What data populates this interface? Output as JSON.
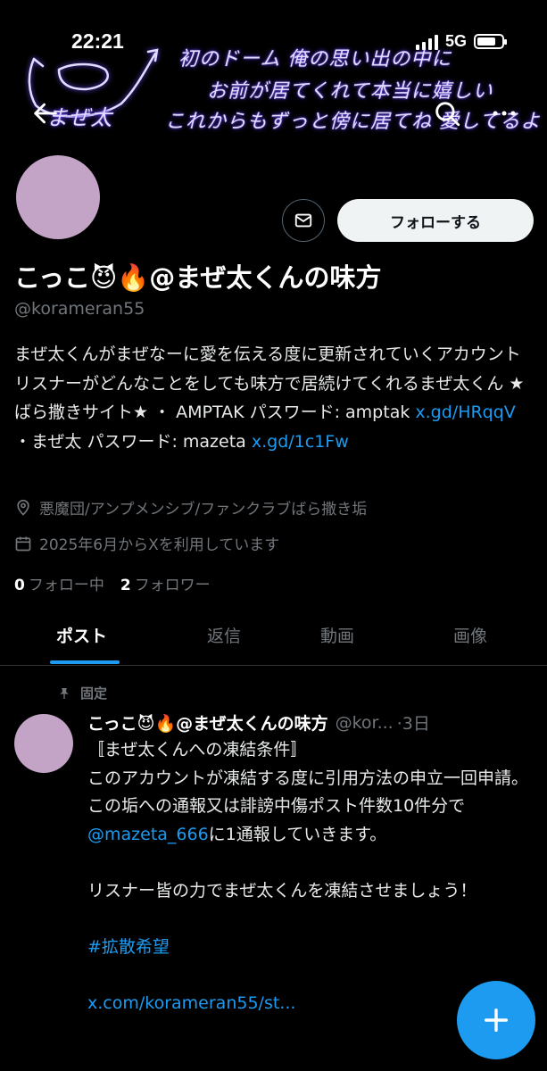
{
  "status_bar": {
    "time": "22:21",
    "network": "5G",
    "battery_level": 0.75
  },
  "banner": {
    "lines": [
      "初のドーム 俺の思い出の中に",
      "お前が居てくれて本当に嬉しい",
      "これからもずっと傍に居てね 愛してるよ"
    ],
    "signature": "まぜ太"
  },
  "nav": {
    "back_icon": "arrow-left-icon",
    "search_icon": "search-icon",
    "more_icon": "more-horizontal-icon"
  },
  "profile": {
    "display_name": "こっこ😈🔥@まぜ太くんの味方",
    "handle": "@korameran55",
    "follow_label": "フォローする",
    "bio_text_1": "まぜ太くんがまぜなーに愛を伝える度に更新されていくアカウント リスナーがどんなことをしても味方で居続けてくれるまぜ太くん ★ばら撒きサイト★ ・ AMPTAK パスワード: amptak ",
    "bio_link_1": "x.gd/HRqqV",
    "bio_text_2": " ・まぜ太 パスワード: mazeta ",
    "bio_link_2": "x.gd/1c1Fw",
    "location": "悪魔団/アンプメンシブ/ファンクラブばら撒き垢",
    "joined": "2025年6月からXを利用しています",
    "following_count": "0",
    "following_label": "フォロー中",
    "followers_count": "2",
    "followers_label": "フォロワー"
  },
  "tabs": [
    "ポスト",
    "返信",
    "動画",
    "画像"
  ],
  "post": {
    "pinned_label": "固定",
    "name": "こっこ😈🔥@まぜ太くんの味方",
    "handle": "@kor...",
    "time": "·3日",
    "line1": "〚まぜ太くんへの凍結条件〛",
    "line2": "このアカウントが凍結する度に引用方法の申立一回申請。",
    "line3": "この垢への通報又は誹謗中傷ポスト件数10件分で",
    "mention": "@mazeta_666",
    "line4": "に1通報していきます。",
    "line5": "リスナー皆の力でまぜ太くんを凍結させましょう！",
    "hashtag": "#拡散希望",
    "url": "x.com/korameran55/st..."
  },
  "colors": {
    "accent": "#1d9bf0",
    "avatar": "#c3a4c6",
    "muted": "#71767b"
  }
}
